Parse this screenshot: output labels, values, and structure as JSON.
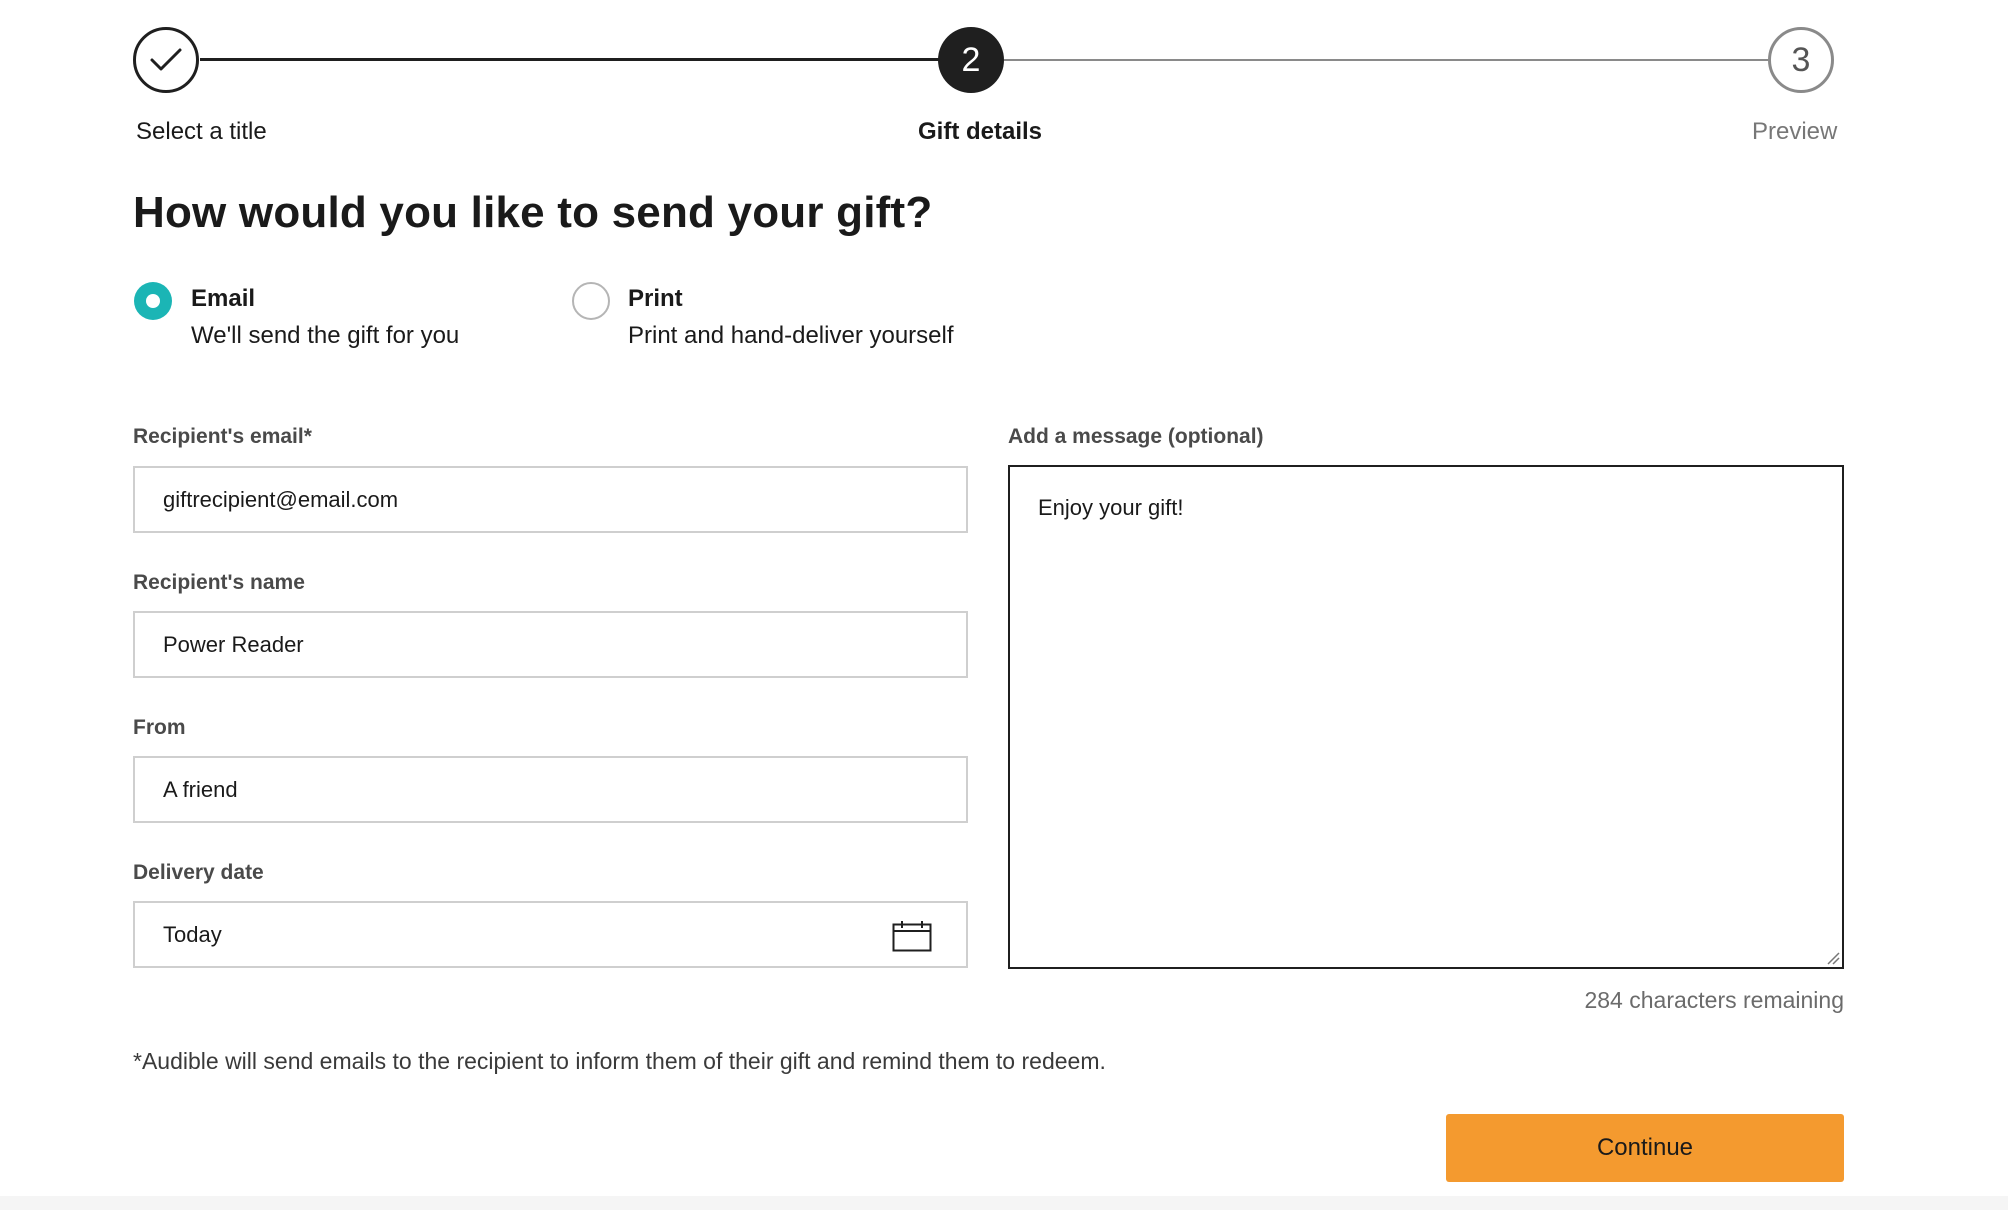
{
  "stepper": {
    "steps": [
      {
        "number": "1",
        "label": "Select a title",
        "status": "complete"
      },
      {
        "number": "2",
        "label": "Gift details",
        "status": "current"
      },
      {
        "number": "3",
        "label": "Preview",
        "status": "upcoming"
      }
    ]
  },
  "page_title": "How would you like to send your gift?",
  "delivery_options": [
    {
      "title": "Email",
      "description": "We'll send the gift for you",
      "selected": true
    },
    {
      "title": "Print",
      "description": "Print and hand-deliver yourself",
      "selected": false
    }
  ],
  "form": {
    "recipient_email": {
      "label": "Recipient's email*",
      "value": "giftrecipient@email.com"
    },
    "recipient_name": {
      "label": "Recipient's name",
      "value": "Power Reader"
    },
    "from": {
      "label": "From",
      "value": "A friend"
    },
    "delivery_date": {
      "label": "Delivery date",
      "value": "Today",
      "icon": "calendar-icon"
    },
    "message": {
      "label": "Add a message (optional)",
      "value": "Enjoy your gift!",
      "remaining": "284 characters remaining"
    }
  },
  "footnote": "*Audible will send emails to the recipient to inform them of their gift and remind them to redeem.",
  "continue_label": "Continue",
  "colors": {
    "accent_teal": "#1bb5b5",
    "button_orange": "#f49a2f",
    "step_dark": "#1f1f1f"
  }
}
